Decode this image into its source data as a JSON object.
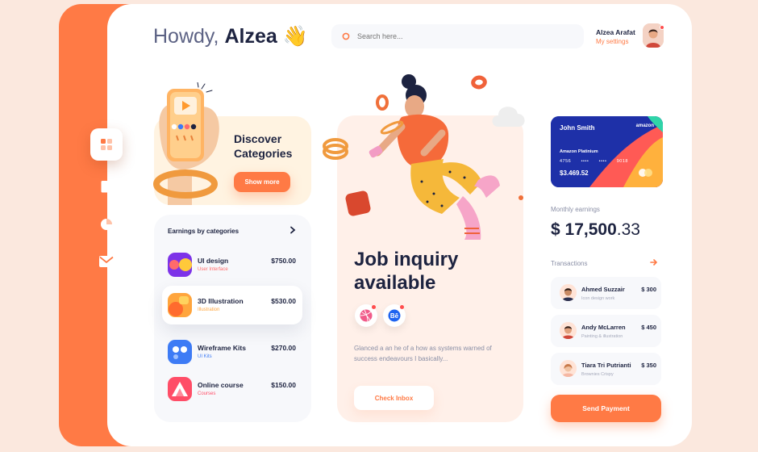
{
  "header": {
    "greeting_prefix": "Howdy,",
    "greeting_name": "Alzea",
    "greeting_emoji": "👋",
    "search_placeholder": "Search here...",
    "user_name": "Alzea Arafat",
    "user_link": "My settings"
  },
  "sidebar": {
    "items": [
      {
        "icon": "grid-icon",
        "active": true
      },
      {
        "icon": "document-icon",
        "active": false
      },
      {
        "icon": "chart-icon",
        "active": false
      },
      {
        "icon": "mail-icon",
        "active": false
      }
    ]
  },
  "discover": {
    "title": "Discover Categories",
    "button": "Show more"
  },
  "earnings_by_category": {
    "title": "Earnings by categories",
    "items": [
      {
        "name": "UI design",
        "sub": "User Interface",
        "amount": "$750.00",
        "color": "#ff6b6b"
      },
      {
        "name": "3D Illustration",
        "sub": "Illustration",
        "amount": "$530.00",
        "color": "#ffa53d"
      },
      {
        "name": "Wireframe Kits",
        "sub": "UI Kits",
        "amount": "$270.00",
        "color": "#3d7bf5"
      },
      {
        "name": "Online course",
        "sub": "Courses",
        "amount": "$150.00",
        "color": "#ff4d67"
      }
    ]
  },
  "job": {
    "title": "Job inquiry available",
    "description": "Glanced a an he of a how as systems warned of success endeavours I basically...",
    "button": "Check Inbox"
  },
  "card": {
    "holder": "John Smith",
    "brand": "amazon",
    "type": "Amazon Platinium",
    "number_parts": [
      "4756",
      "••••",
      "••••",
      "9018"
    ],
    "balance": "$3.469.52"
  },
  "monthly": {
    "label": "Monthly earnings",
    "amount_main": "$ 17,500",
    "amount_cents": ".33"
  },
  "transactions": {
    "label": "Transactions",
    "items": [
      {
        "name": "Ahmed Suzzair",
        "sub": "Icon design work",
        "amount": "$ 300"
      },
      {
        "name": "Andy McLarren",
        "sub": "Painting & illustration",
        "amount": "$ 450"
      },
      {
        "name": "Tiara Tri Putrianti",
        "sub": "Brownies Crispy",
        "amount": "$ 350"
      }
    ],
    "button": "Send Payment"
  },
  "colors": {
    "accent": "#ff7a45",
    "navy": "#1d2340",
    "muted": "#8a8fa6"
  }
}
